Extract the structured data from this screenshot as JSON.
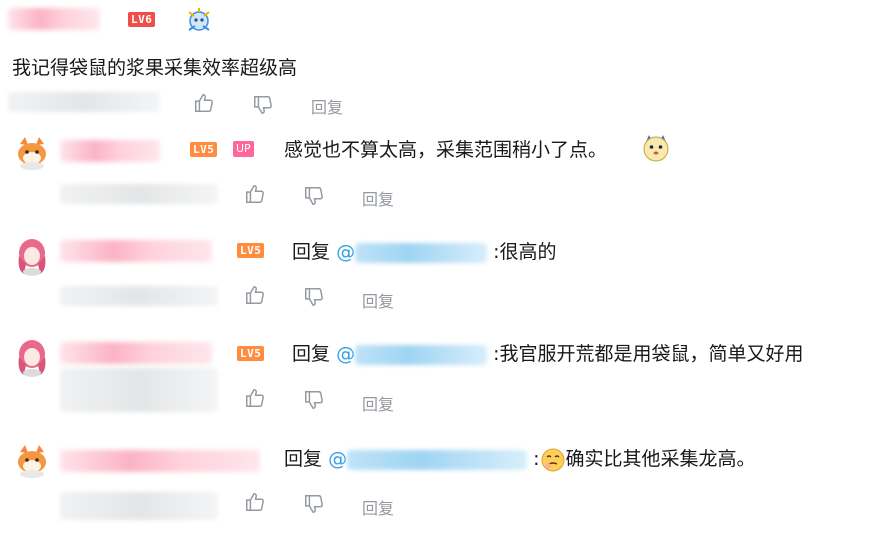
{
  "comment": {
    "level_badge": "LV6",
    "text": "我记得袋鼠的浆果采集效率超级高",
    "reply_label": "回复"
  },
  "replies": [
    {
      "level_badge": "LV5",
      "up_badge": "UP",
      "text": "感觉也不算太高，采集范围稍小了点。",
      "reply_label": "回复"
    },
    {
      "level_badge": "LV5",
      "prefix": "回复",
      "at": "@",
      "text": ":很高的",
      "reply_label": "回复"
    },
    {
      "level_badge": "LV5",
      "prefix": "回复",
      "at": "@",
      "text": ":我官服开荒都是用袋鼠，简单又好用",
      "reply_label": "回复"
    },
    {
      "prefix": "回复",
      "at": "@",
      "text": "确实比其他采集龙高。",
      "colon": ":",
      "reply_label": "回复"
    }
  ],
  "colors": {
    "accent_link": "#2fa0e6",
    "level5": "#ff8c3f",
    "level6": "#f04c49",
    "up_badge": "#ff6699",
    "action_gray": "#9499a0"
  }
}
